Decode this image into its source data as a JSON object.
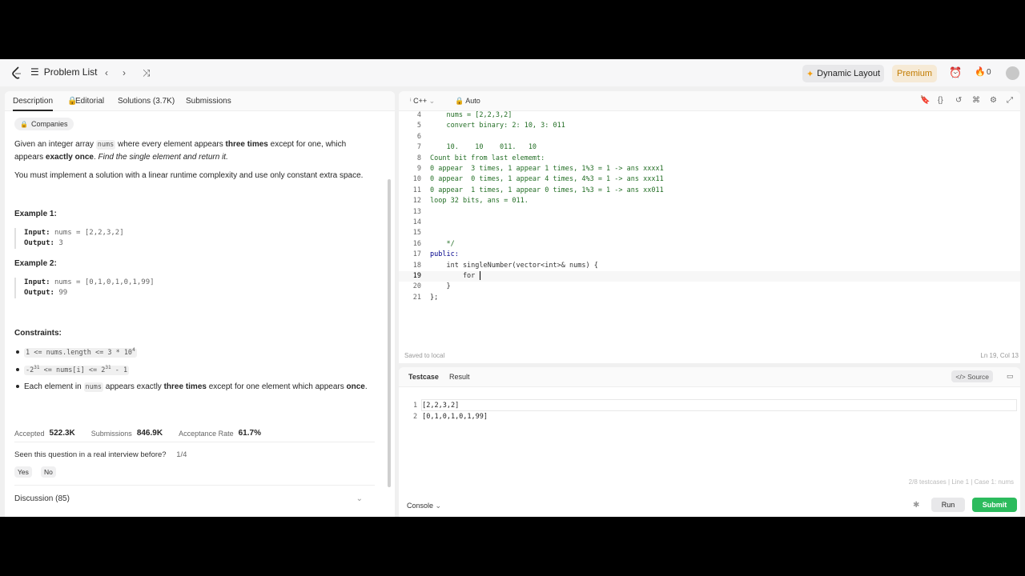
{
  "topbar": {
    "problem_list": "Problem List",
    "dynamic_layout": "Dynamic Layout",
    "premium": "Premium",
    "streak": "0"
  },
  "left_tabs": [
    "Description",
    "Editorial",
    "Solutions (3.7K)",
    "Submissions"
  ],
  "description": {
    "companies": "Companies",
    "intro_1": "Given an integer array ",
    "intro_code": "nums",
    "intro_2": " where every element appears ",
    "intro_bold1": "three times",
    "intro_3": " except for one, which appears ",
    "intro_bold2": "exactly once",
    "intro_4": ". ",
    "intro_italic": "Find the single element and return it.",
    "para2": "You must implement a solution with a linear runtime complexity and use only constant extra space.",
    "example1_title": "Example 1:",
    "example1_input_label": "Input:",
    "example1_input": "nums = [2,2,3,2]",
    "example1_output_label": "Output:",
    "example1_output": "3",
    "example2_title": "Example 2:",
    "example2_input_label": "Input:",
    "example2_input": "nums = [0,1,0,1,0,1,99]",
    "example2_output_label": "Output:",
    "example2_output": "99",
    "constraints_title": "Constraints:",
    "c1": "1 <= nums.length <= 3 * 10",
    "c1_sup": "4",
    "c2a": "-2",
    "c2a_sup": "31",
    "c2b": " <= nums[i] <= 2",
    "c2b_sup": "31",
    "c2c": " - 1",
    "c3_1": "Each element in ",
    "c3_code": "nums",
    "c3_2": " appears exactly ",
    "c3_bold1": "three times",
    "c3_3": " except for one element which appears ",
    "c3_bold2": "once",
    "c3_4": "."
  },
  "stats": {
    "accepted_label": "Accepted",
    "accepted": "522.3K",
    "submissions_label": "Submissions",
    "submissions": "846.9K",
    "rate_label": "Acceptance Rate",
    "rate": "61.7%"
  },
  "interview": {
    "question": "Seen this question in a real interview before?",
    "count": "1/4",
    "yes": "Yes",
    "no": "No"
  },
  "discussion": "Discussion (85)",
  "editor": {
    "language": "C++",
    "mode": "Auto",
    "saved": "Saved to local",
    "cursor_pos": "Ln 19, Col 13",
    "lines": [
      {
        "n": "4",
        "text": "    nums = [2,2,3,2]",
        "kind": "comment"
      },
      {
        "n": "5",
        "text": "    convert binary: 2: 10, 3: 011",
        "kind": "comment"
      },
      {
        "n": "6",
        "text": "",
        "kind": "comment"
      },
      {
        "n": "7",
        "text": "    10.    10    011.   10",
        "kind": "comment"
      },
      {
        "n": "8",
        "text": "Count bit from last elememt:",
        "kind": "comment"
      },
      {
        "n": "9",
        "text": "0 appear  3 times, 1 appear 1 times, 1%3 = 1 -> ans xxxx1",
        "kind": "comment"
      },
      {
        "n": "10",
        "text": "0 appear  0 times, 1 appear 4 times, 4%3 = 1 -> ans xxx11",
        "kind": "comment"
      },
      {
        "n": "11",
        "text": "0 appear  1 times, 1 appear 0 times, 1%3 = 1 -> ans xx011",
        "kind": "comment"
      },
      {
        "n": "12",
        "text": "loop 32 bits, ans = 011.",
        "kind": "comment"
      },
      {
        "n": "13",
        "text": "",
        "kind": "comment"
      },
      {
        "n": "14",
        "text": "",
        "kind": "comment"
      },
      {
        "n": "15",
        "text": "",
        "kind": "comment"
      },
      {
        "n": "16",
        "text": "    */",
        "kind": "comment"
      },
      {
        "n": "17",
        "text": "public:",
        "kind": "keyword"
      },
      {
        "n": "18",
        "text": "    int singleNumber(vector<int>& nums) {",
        "kind": "normal"
      },
      {
        "n": "19",
        "text": "        for ",
        "kind": "normal"
      },
      {
        "n": "20",
        "text": "    }",
        "kind": "normal"
      },
      {
        "n": "21",
        "text": "};",
        "kind": "normal"
      }
    ]
  },
  "testcase": {
    "tab_testcase": "Testcase",
    "tab_result": "Result",
    "source": "Source",
    "lines": [
      {
        "n": "1",
        "text": "[2,2,3,2]"
      },
      {
        "n": "2",
        "text": "[0,1,0,1,0,1,99]"
      }
    ],
    "footer": "2/8 testcases  |  Line 1  |  Case 1: nums",
    "console": "Console",
    "run": "Run",
    "submit": "Submit"
  }
}
